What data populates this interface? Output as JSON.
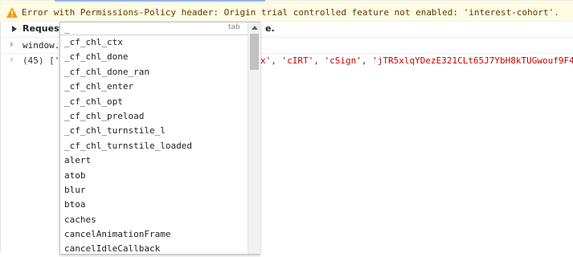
{
  "warning": {
    "text": "Error with Permissions-Policy header: Origin trial controlled feature not enabled: 'interest-cohort'.",
    "color": "#5c3c00"
  },
  "request_row": {
    "label": "Request",
    "tail": "e."
  },
  "input_row": {
    "text": "window."
  },
  "output_row": {
    "prefix": "(45) ['",
    "items": [
      "x'",
      ", ",
      "'cIRT'",
      ", ",
      "'cSign'",
      ", ",
      "'jTR5xlqYDezE321CLt65J7YbH8kTUGwouf9F4"
    ]
  },
  "autocomplete": {
    "input_value": "_",
    "tab_hint": "tab",
    "items": [
      "_cf_chl_ctx",
      "_cf_chl_done",
      "_cf_chl_done_ran",
      "_cf_chl_enter",
      "_cf_chl_opt",
      "_cf_chl_preload",
      "_cf_chl_turnstile_l",
      "_cf_chl_turnstile_loaded",
      "alert",
      "atob",
      "blur",
      "btoa",
      "caches",
      "cancelAnimationFrame",
      "cancelIdleCallback"
    ]
  },
  "colors": {
    "link_blue": "#1a73e8",
    "string_red": "#c80000",
    "warning_bg": "#fffbe5"
  }
}
